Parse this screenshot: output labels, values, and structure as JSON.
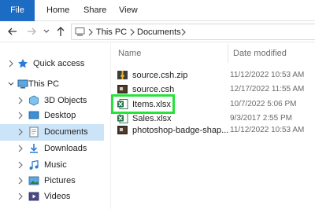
{
  "ribbon": {
    "tabs": [
      "File",
      "Home",
      "Share",
      "View"
    ]
  },
  "address": {
    "crumbs": [
      "This PC",
      "Documents"
    ]
  },
  "nav": {
    "items": [
      {
        "label": "Quick access",
        "icon": "star-icon"
      },
      {
        "label": "This PC",
        "icon": "computer-icon"
      },
      {
        "label": "3D Objects",
        "icon": "cube-icon"
      },
      {
        "label": "Desktop",
        "icon": "desktop-icon"
      },
      {
        "label": "Documents",
        "icon": "documents-icon"
      },
      {
        "label": "Downloads",
        "icon": "downloads-icon"
      },
      {
        "label": "Music",
        "icon": "music-icon"
      },
      {
        "label": "Pictures",
        "icon": "pictures-icon"
      },
      {
        "label": "Videos",
        "icon": "videos-icon"
      }
    ]
  },
  "filelist": {
    "headers": {
      "name": "Name",
      "date": "Date modified"
    },
    "files": [
      {
        "name": "source.csh.zip",
        "date": "11/12/2022 10:53 AM",
        "icon": "archive-icon"
      },
      {
        "name": "source.csh",
        "date": "12/17/2022 11:55 AM",
        "icon": "photoshop-file-icon"
      },
      {
        "name": "Items.xlsx",
        "date": "10/7/2022 5:06 PM",
        "icon": "excel-file-icon"
      },
      {
        "name": "Sales.xlsx",
        "date": "9/3/2017 2:55 PM",
        "icon": "excel-file-icon"
      },
      {
        "name": "photoshop-badge-shap...",
        "date": "11/12/2022 10:53 AM",
        "icon": "photoshop-file-icon"
      }
    ]
  },
  "colors": {
    "file_tab": "#1c6cc4",
    "selected_nav": "#cce4f7",
    "highlight_box": "#27e23a"
  }
}
